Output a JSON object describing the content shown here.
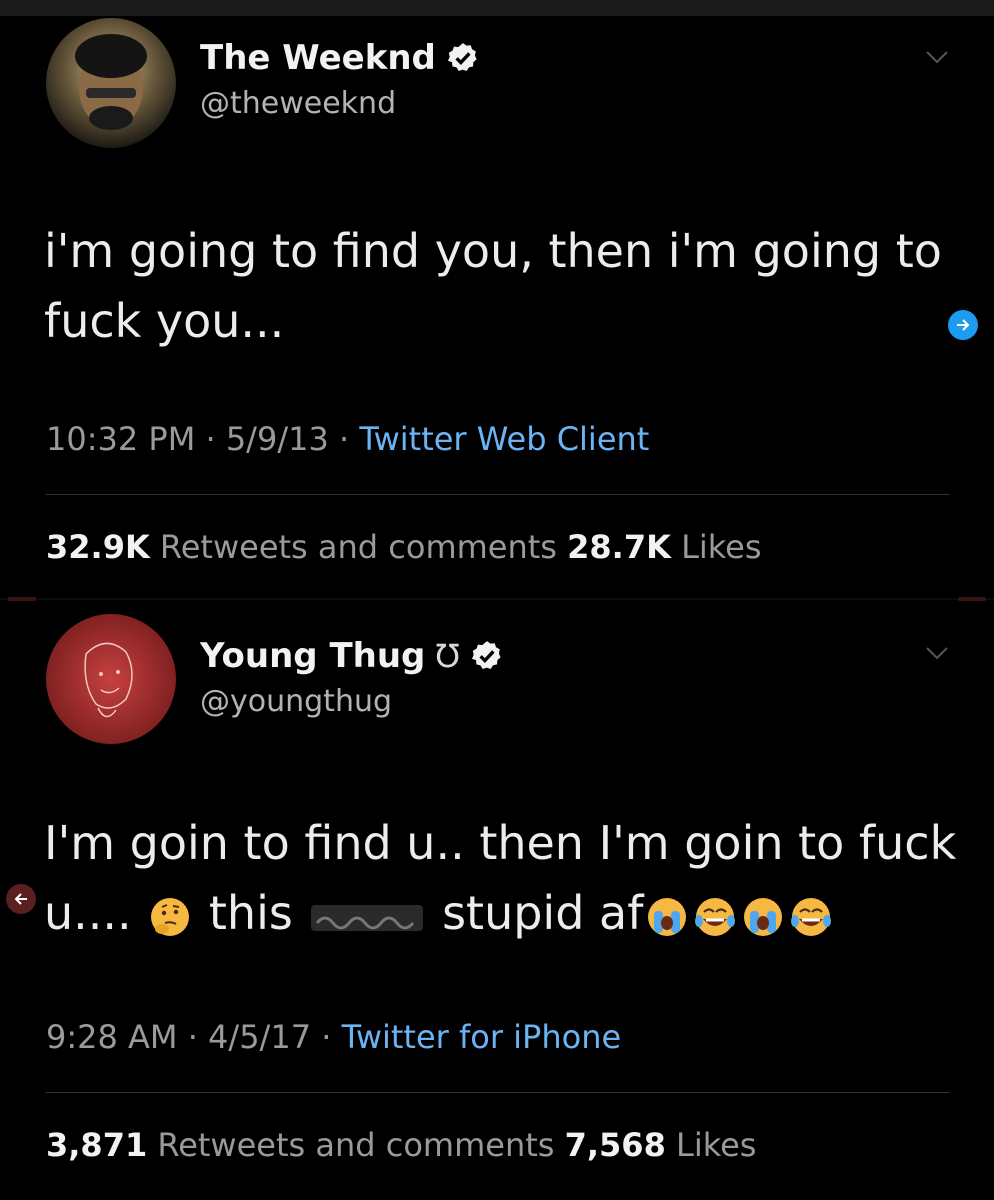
{
  "tweets": [
    {
      "name": "The Weeknd",
      "handle": "@theweeknd",
      "text_lines": [
        "i'm going to find you, then i'm going to",
        "fuck you..."
      ],
      "time": "10:32 PM · 5/9/13 · ",
      "source": "Twitter Web Client",
      "retweets": "32.9K",
      "retweets_label": " Retweets and comments ",
      "likes": "28.7K",
      "likes_label": " Likes"
    },
    {
      "name": "Young Thug",
      "name_symbol": "Ʊ",
      "handle": "@youngthug",
      "text_line1": "I'm goin to find u.. then I'm goin to fuck",
      "text_line2_a": "u.... ",
      "text_line2_b": " this ",
      "text_line2_c": " stupid af",
      "time": "9:28 AM · 4/5/17 · ",
      "source": "Twitter for iPhone",
      "retweets": "3,871",
      "retweets_label": " Retweets and comments ",
      "likes": "7,568",
      "likes_label": " Likes"
    }
  ],
  "icons": {
    "verified": "verified-badge-icon",
    "caret": "chevron-down-icon",
    "thinking": "thinking-face-emoji",
    "crying": "loudly-crying-face-emoji",
    "laughing": "tears-of-joy-emoji"
  },
  "colors": {
    "background": "#000000",
    "link": "#6bb3f2",
    "verified": "#f2f2f2"
  }
}
